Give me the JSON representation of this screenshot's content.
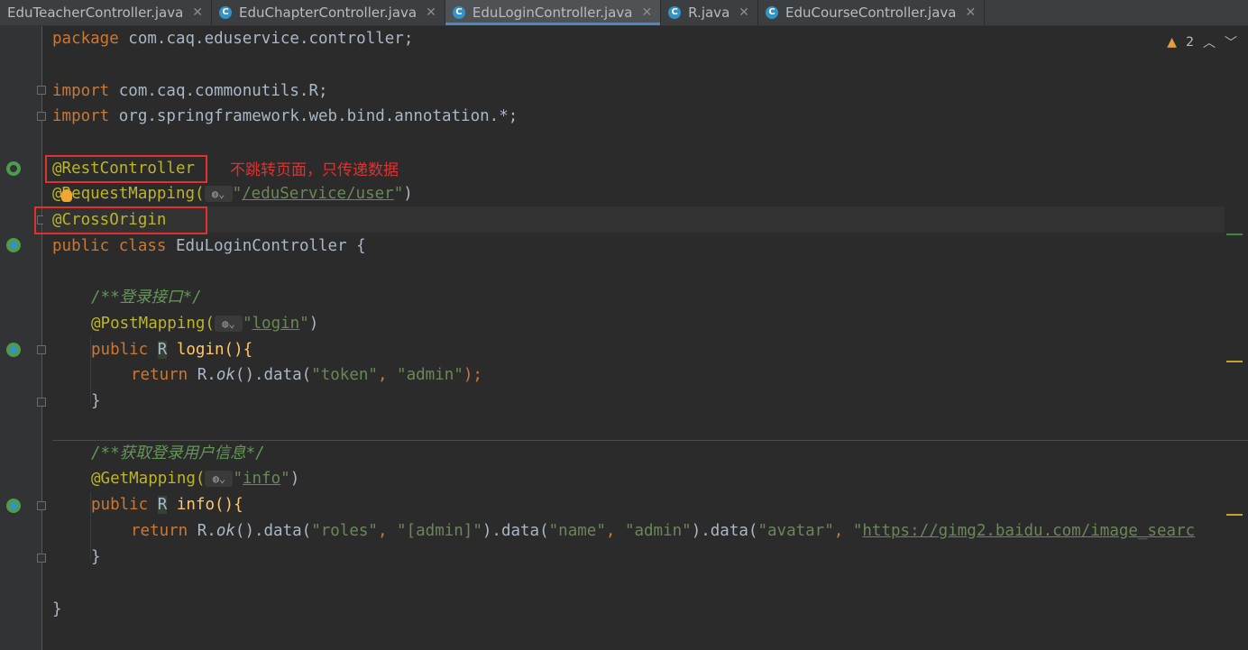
{
  "tabs": [
    {
      "label": "EduTeacherController.java",
      "active": false,
      "icon": false
    },
    {
      "label": "EduChapterController.java",
      "active": false,
      "icon": true
    },
    {
      "label": "EduLoginController.java",
      "active": true,
      "icon": true
    },
    {
      "label": "R.java",
      "active": false,
      "icon": true
    },
    {
      "label": "EduCourseController.java",
      "active": false,
      "icon": true
    }
  ],
  "tab_icon_letter": "C",
  "close_glyph": "✕",
  "inspection": {
    "warnings": "2",
    "icon": "warning-icon"
  },
  "code": {
    "package_kw": "package",
    "package_name": " com.caq.eduservice.controller;",
    "import_kw": "import",
    "import1": " com.caq.commonutils.R;",
    "import2": " org.springframework.web.bind.annotation.*;",
    "rest_controller": "@RestController",
    "request_mapping": "@RequestMapping(",
    "request_path": "/eduService/user",
    "cross_origin": "@CrossOrigin",
    "class_kw": "public class",
    "class_name": " EduLoginController {",
    "comment_login": "/**登录接口*/",
    "post_mapping": "@PostMapping(",
    "login_path": "login",
    "public_kw": "public",
    "return_type": "R",
    "login_sig": " login(){",
    "return_kw": "return",
    "login_return_a": " R.",
    "ok": "ok",
    "login_return_b": "().data(",
    "token_key": "\"token\"",
    "token_val": "\"admin\"",
    "close_brace": "}",
    "comment_info": "/**获取登录用户信息*/",
    "get_mapping": "@GetMapping(",
    "info_path": "info",
    "info_sig": " info(){",
    "roles_key": "\"roles\"",
    "roles_val": "\"[admin]\"",
    "name_key": "\"name\"",
    "name_val": "\"admin\"",
    "avatar_key": "\"avatar\"",
    "avatar_url": "https://gimg2.baidu.com/image_searc"
  },
  "annotation_note": "不跳转页面，只传递数据",
  "colors": {
    "keyword": "#cc7832",
    "annotation": "#bbb529",
    "string": "#6a8759",
    "highlight_box": "#e0312f"
  }
}
